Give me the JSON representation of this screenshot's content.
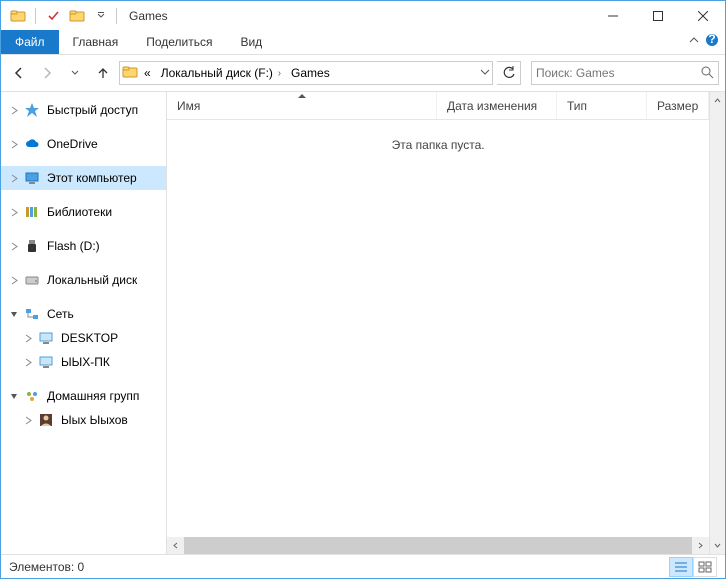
{
  "title": "Games",
  "ribbon": {
    "file": "Файл",
    "tabs": [
      "Главная",
      "Поделиться",
      "Вид"
    ]
  },
  "breadcrumb": {
    "prefix": "«",
    "parts": [
      "Локальный диск (F:)",
      "Games"
    ]
  },
  "search_placeholder": "Поиск: Games",
  "columns": {
    "name": "Имя",
    "date": "Дата изменения",
    "type": "Тип",
    "size": "Размер"
  },
  "empty_text": "Эта папка пуста.",
  "tree": [
    {
      "label": "Быстрый доступ",
      "icon": "star",
      "expander": "right",
      "indent": 0
    },
    {
      "label": "OneDrive",
      "icon": "cloud",
      "expander": "right",
      "indent": 0
    },
    {
      "label": "Этот компьютер",
      "icon": "pc",
      "expander": "right",
      "indent": 0,
      "selected": true
    },
    {
      "label": "Библиотеки",
      "icon": "libs",
      "expander": "right",
      "indent": 0
    },
    {
      "label": "Flash (D:)",
      "icon": "usb",
      "expander": "right",
      "indent": 0
    },
    {
      "label": "Локальный диск",
      "icon": "hdd",
      "expander": "right",
      "indent": 0
    },
    {
      "label": "Сеть",
      "icon": "net",
      "expander": "down",
      "indent": 0
    },
    {
      "label": "DESKTOP",
      "icon": "netpc",
      "expander": "right",
      "indent": 1
    },
    {
      "label": "ЫЫХ-ПК",
      "icon": "netpc",
      "expander": "right",
      "indent": 1
    },
    {
      "label": "Домашняя групп",
      "icon": "home",
      "expander": "down",
      "indent": 0
    },
    {
      "label": "Ыых Ыыхов",
      "icon": "user",
      "expander": "right",
      "indent": 1
    }
  ],
  "status": {
    "items": "Элементов: 0"
  },
  "colors": {
    "accent": "#1979ca",
    "selection": "#cce8ff"
  }
}
